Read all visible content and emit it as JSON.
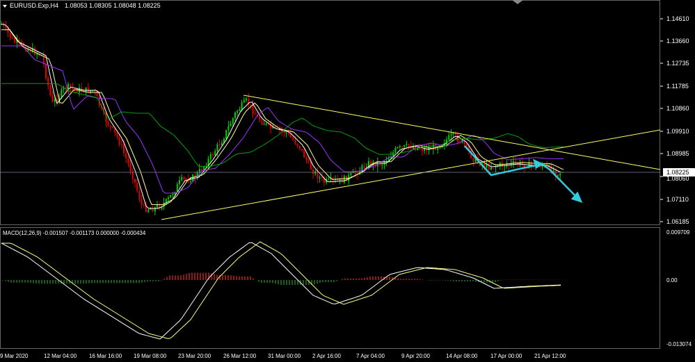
{
  "header": {
    "symbol_label": "EURUSD.Exp,H4",
    "ohlc_label": "1.08053 1.08305 1.08048 1.08225"
  },
  "price_axis": {
    "ticks": [
      "1.14610",
      "1.13660",
      "1.12735",
      "1.11785",
      "1.10860",
      "1.09910",
      "1.08985",
      "1.08060",
      "1.07110",
      "1.06185"
    ],
    "current_price_tag": "1.08225"
  },
  "macd_panel": {
    "label": "MACD(12,26,9) -0.001507 -0.001173 0.000000 -0.000434",
    "ticks": [
      "0.009709",
      "0.00",
      "-0.013074"
    ]
  },
  "time_axis": {
    "labels": [
      "9 Mar 2020",
      "12 Mar 04:00",
      "16 Mar 16:00",
      "19 Mar 08:00",
      "23 Mar 20:00",
      "26 Mar 12:00",
      "31 Mar 00:00",
      "2 Apr 16:00",
      "7 Apr 04:00",
      "9 Apr 20:00",
      "14 Apr 08:00",
      "17 Apr 00:00",
      "21 Apr 12:00"
    ]
  },
  "colors": {
    "background": "#000000",
    "bull_candle": "#00d000",
    "bear_candle": "#e00000",
    "trendline": "#ffff66",
    "ma_fast": "#ffffff",
    "ma_mid": "#ffff99",
    "ma_slow": "#9933ff",
    "ma_long": "#00a000",
    "arrow": "#33ccdd",
    "grid_line": "#8080a0",
    "macd_line": "#ffffff",
    "signal_line": "#ffff80",
    "hist_pos": "#c02020",
    "hist_neg": "#208020"
  },
  "icons": {
    "dropdown": "triangle-down-icon"
  }
}
